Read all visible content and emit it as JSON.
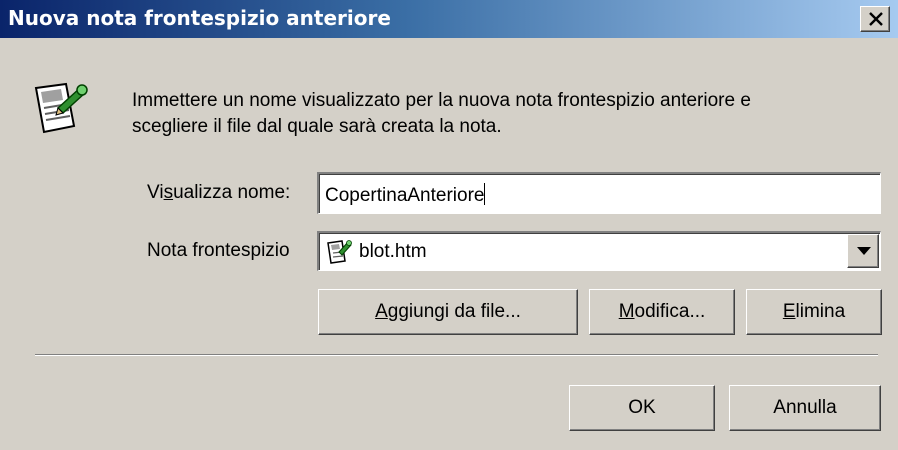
{
  "dialog": {
    "title": "Nuova nota frontespizio anteriore",
    "close_icon": "close-icon",
    "icon": "cover-page-icon",
    "intro_line1": "Immettere un nome visualizzato per la nuova nota frontespizio anteriore e",
    "intro_line2": "scegliere il file dal quale sarà creata la nota."
  },
  "display_name": {
    "label_pre": "Vi",
    "label_accel": "s",
    "label_post": "ualizza nome:",
    "value": "CopertinaAnteriore"
  },
  "cover_note": {
    "label": "Nota frontespizio",
    "selected": "blot.htm",
    "icon": "cover-page-file-icon",
    "dropdown_icon": "chevron-down-icon"
  },
  "buttons": {
    "add": {
      "accel": "A",
      "rest": "ggiungi da file..."
    },
    "edit": {
      "accel": "M",
      "rest": "odifica..."
    },
    "delete": {
      "accel": "E",
      "rest": "limina"
    },
    "ok": "OK",
    "cancel": "Annulla"
  },
  "colors": {
    "titlebar_start": "#0a246a",
    "titlebar_end": "#a6caf0",
    "face": "#d4d0c8"
  }
}
